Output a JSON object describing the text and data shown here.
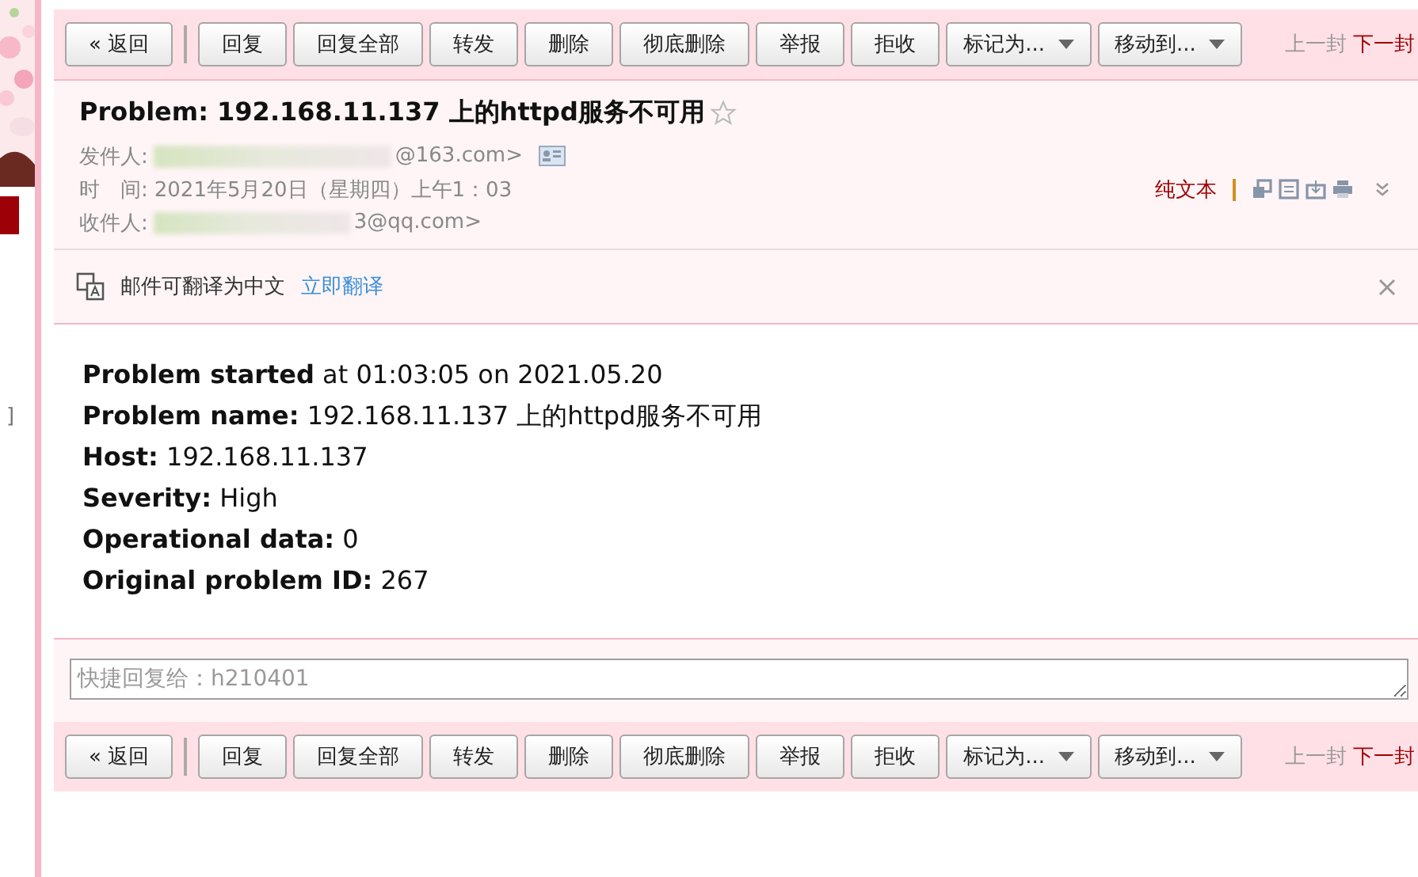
{
  "sidebar": {
    "fragment": "]"
  },
  "toolbar_top": {
    "buttons": [
      {
        "label": "« 返回",
        "kind": "button"
      },
      {
        "label": "回复",
        "kind": "button"
      },
      {
        "label": "回复全部",
        "kind": "button"
      },
      {
        "label": "转发",
        "kind": "button"
      },
      {
        "label": "删除",
        "kind": "button"
      },
      {
        "label": "彻底删除",
        "kind": "button"
      },
      {
        "label": "举报",
        "kind": "button"
      },
      {
        "label": "拒收",
        "kind": "button"
      },
      {
        "label": "标记为...",
        "kind": "dropdown"
      },
      {
        "label": "移动到...",
        "kind": "dropdown"
      }
    ],
    "prev": {
      "label": "上一封",
      "disabled": true
    },
    "next": {
      "label": "下一封",
      "disabled": false
    }
  },
  "header": {
    "subject": "Problem: 192.168.11.137 上的httpd服务不可用",
    "starred": false,
    "fields": [
      {
        "label": "发件人:",
        "value": "@163.com>",
        "redacted": true
      },
      {
        "label": "时　间:",
        "value": "2021年5月20日（星期四）上午1：03",
        "redacted": false
      },
      {
        "label": "收件人:",
        "value": "3@qq.com>",
        "redacted": true
      }
    ],
    "plain_text_link": "纯文本"
  },
  "translate_bar": {
    "text": "邮件可翻译为中文",
    "link": "立即翻译"
  },
  "body": [
    {
      "label": "Problem started",
      "value": "at 01:03:05 on 2021.05.20"
    },
    {
      "label": "Problem name:",
      "value": "192.168.11.137 上的httpd服务不可用"
    },
    {
      "label": "Host:",
      "value": "192.168.11.137"
    },
    {
      "label": "Severity:",
      "value": "High"
    },
    {
      "label": "Operational data:",
      "value": "0"
    },
    {
      "label": "Original problem ID:",
      "value": "267"
    }
  ],
  "quick_reply": {
    "placeholder": "快捷回复给：h210401"
  },
  "toolbar_bottom": {
    "buttons": [
      {
        "label": "« 返回",
        "kind": "button"
      },
      {
        "label": "回复",
        "kind": "button"
      },
      {
        "label": "回复全部",
        "kind": "button"
      },
      {
        "label": "转发",
        "kind": "button"
      },
      {
        "label": "删除",
        "kind": "button"
      },
      {
        "label": "彻底删除",
        "kind": "button"
      },
      {
        "label": "举报",
        "kind": "button"
      },
      {
        "label": "拒收",
        "kind": "button"
      },
      {
        "label": "标记为...",
        "kind": "dropdown"
      },
      {
        "label": "移动到...",
        "kind": "dropdown"
      }
    ],
    "prev": {
      "label": "上一封",
      "disabled": true
    },
    "next": {
      "label": "下一封",
      "disabled": false
    }
  }
}
